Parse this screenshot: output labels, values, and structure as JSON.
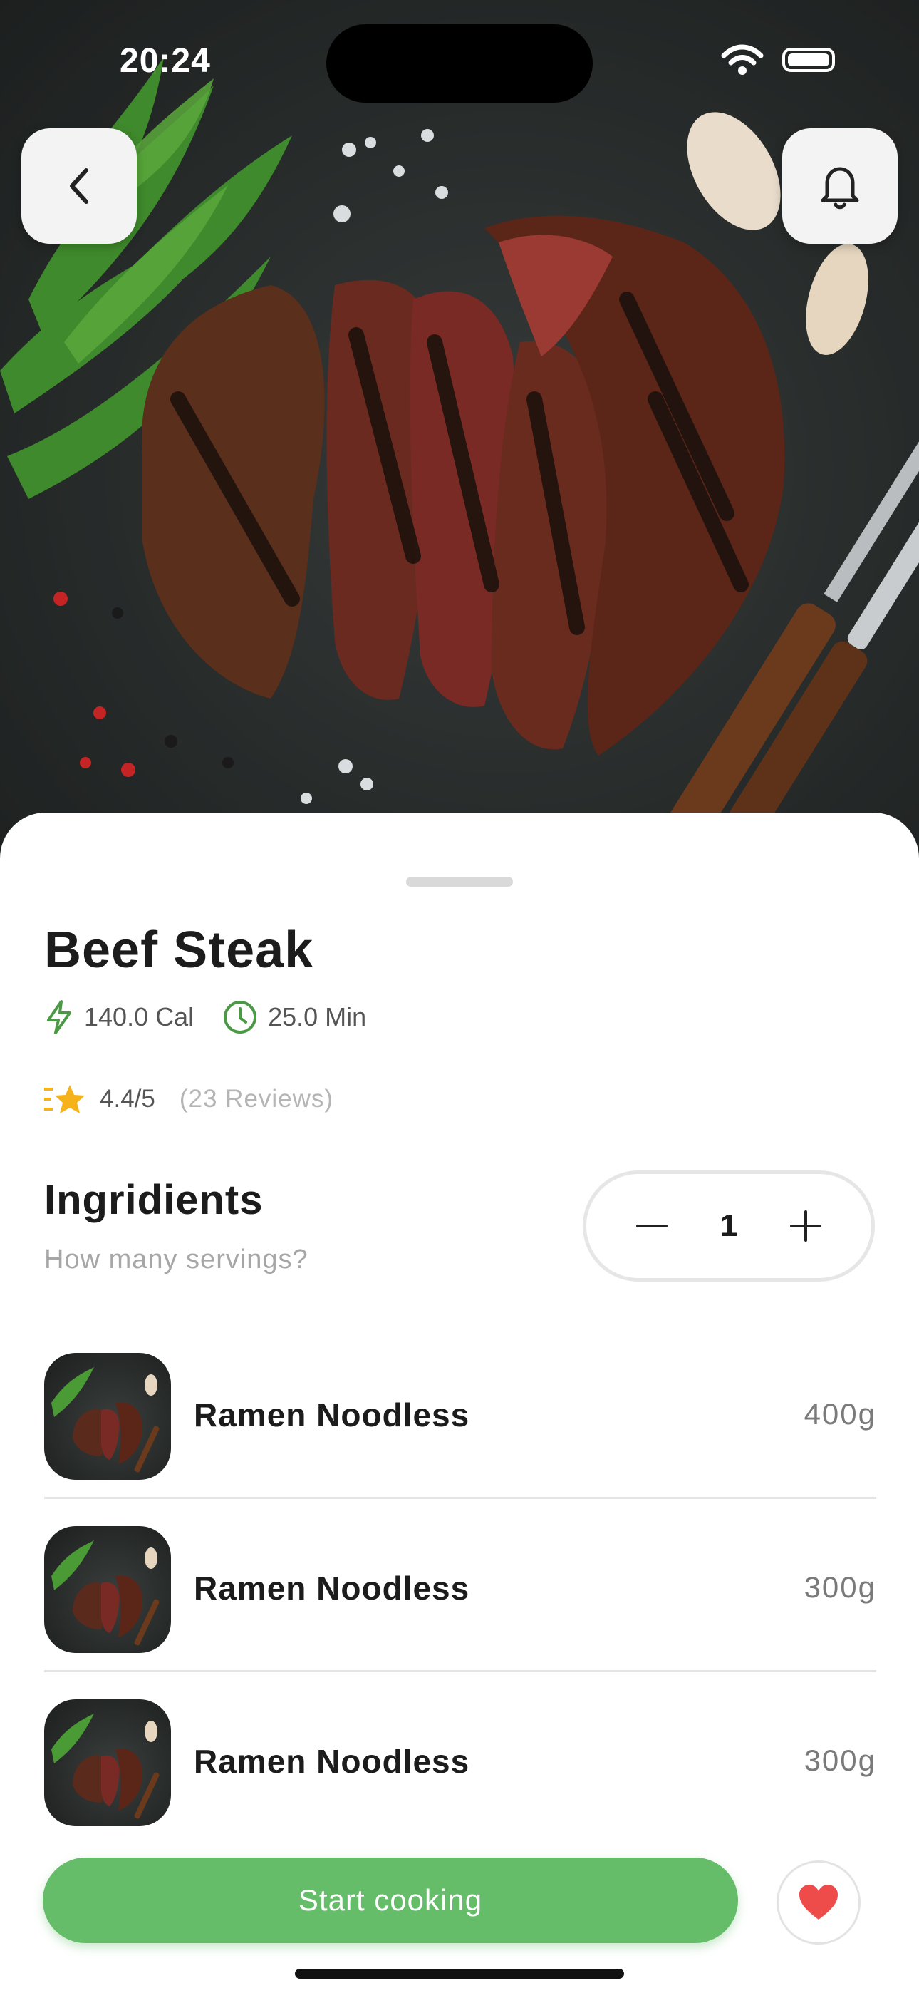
{
  "status_bar": {
    "time": "20:24"
  },
  "recipe": {
    "title": "Beef Steak",
    "calories": "140.0 Cal",
    "duration": "25.0 Min",
    "rating": "4.4/5",
    "reviews": "(23 Reviews)"
  },
  "ingredients": {
    "title": "Ingridients",
    "subtitle": "How many servings?",
    "servings": "1",
    "items": [
      {
        "name": "Ramen Noodless",
        "amount": "400g"
      },
      {
        "name": "Ramen Noodless",
        "amount": "300g"
      },
      {
        "name": "Ramen Noodless",
        "amount": "300g"
      }
    ]
  },
  "actions": {
    "start_label": "Start cooking"
  },
  "colors": {
    "accent": "#65bd6a",
    "heart": "#ee4b4b",
    "star": "#f6b21b"
  }
}
